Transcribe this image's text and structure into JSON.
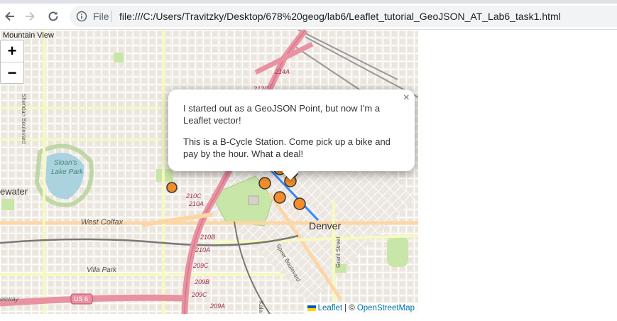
{
  "browser": {
    "url_prefix": "File",
    "url": "file:///C:/Users/Travitzky/Desktop/678%20geog/lab6/Leaflet_tutorial_GeoJSON_AT_Lab6_task1.html"
  },
  "map": {
    "labels": {
      "mountain_view": "Mountain View",
      "sheridan": "Sheridan Boulevard",
      "sloans_lake": "Sloan's Lake Park",
      "sloans_line1": "Sloan's",
      "sloans_line2": "Lake Park",
      "lakewood_partial": "ewater",
      "west_colfax": "West Colfax",
      "villa_park": "Villa Park",
      "denver": "Denver",
      "speer": "Speer Boulevard",
      "grant": "Grant Street",
      "us6": "US 6",
      "freeway_partial": "eeway",
      "exit_214a": "214A",
      "exit_212c": "212C",
      "exit_210c": "210C",
      "exit_210a": "210A",
      "exit_210b": "210B",
      "exit_210a2": "210A",
      "exit_209c": "209C",
      "exit_209b": "209B",
      "exit_209a": "209A",
      "kala": "Kala"
    },
    "zoom_in": "+",
    "zoom_out": "−",
    "popup": {
      "close": "×",
      "line1": "I started out as a GeoJSON Point, but now I'm a Leaflet vector!",
      "line2": "This is a B-Cycle Station. Come pick up a bike and pay by the hour. What a deal!"
    },
    "attribution": {
      "leaflet": "Leaflet",
      "separator": "| ©",
      "osm": "OpenStreetMap"
    },
    "colors": {
      "marker_fill": "#f28d2a",
      "marker_stroke": "#333333",
      "line": "#3388ff",
      "park": "#c8e6a7",
      "water": "#aad3df",
      "motorway": "#e892a2"
    },
    "markers": 7
  }
}
